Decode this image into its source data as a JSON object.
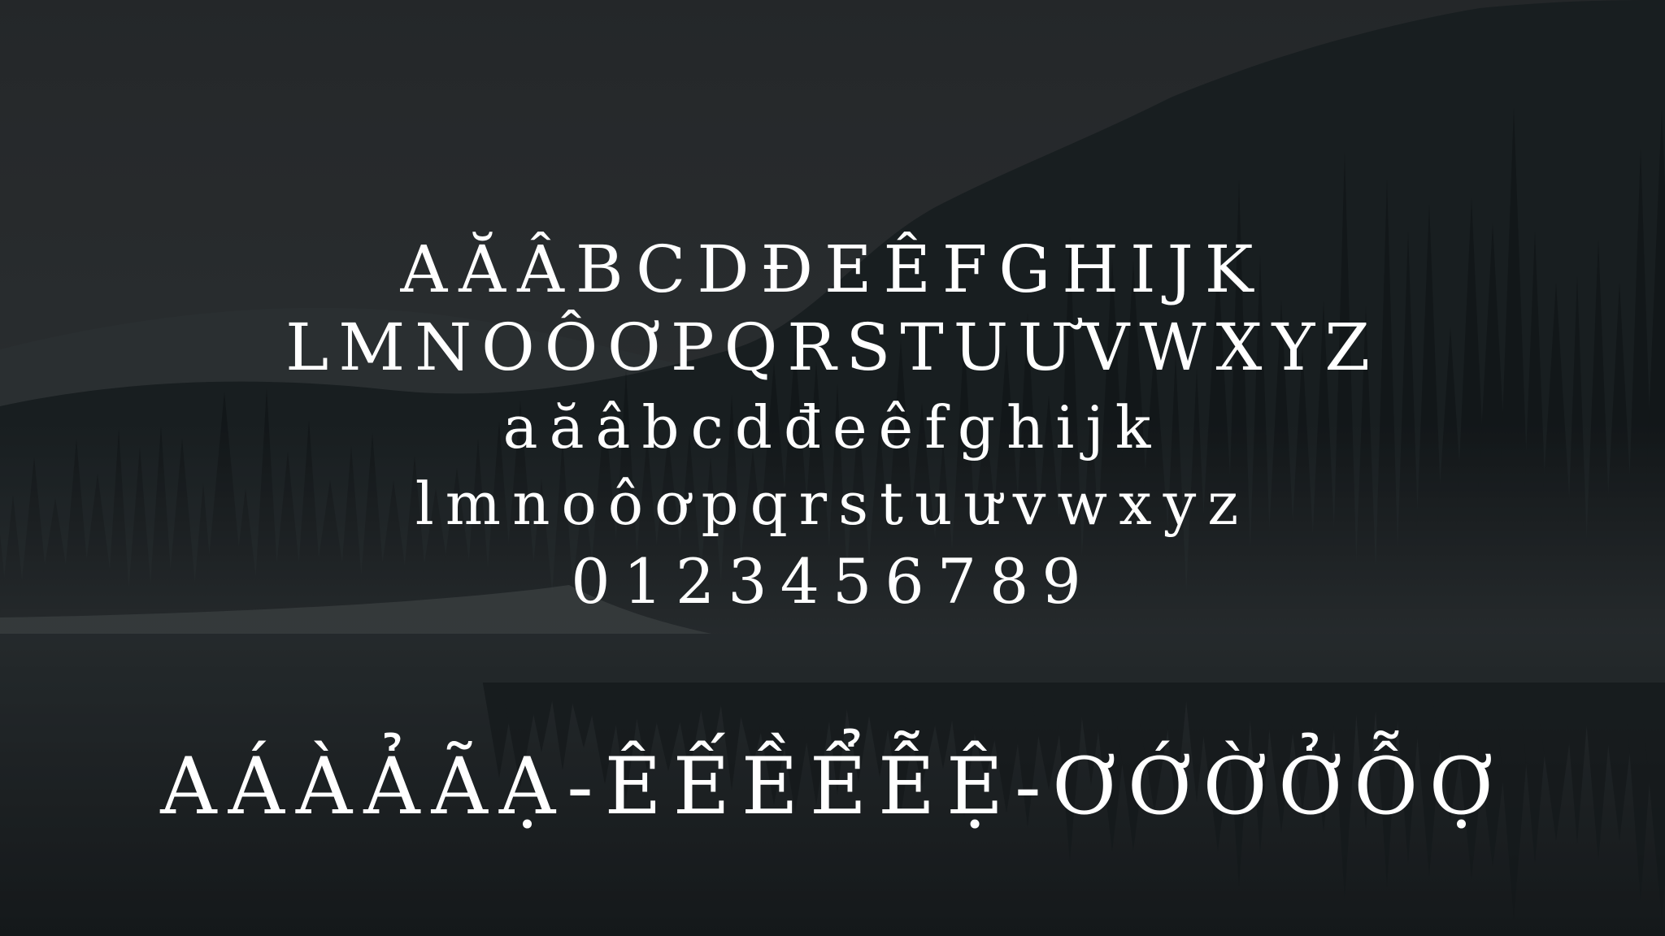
{
  "specimen": {
    "uppercase_line_1": "AĂÂBCDĐEÊFGHIJK",
    "uppercase_line_2": "LMNOÔƠPQRSTUƯVWXYZ",
    "lowercase_line_1": "aăâbcdđeêfghijk",
    "lowercase_line_2": "lmnoôơpqrstuưvwxyz",
    "digits": "0123456789",
    "diacritics": "AÁÀẢÃẠ-ÊẾỀỂỄỆ-ƠỚỜỞỖỢ"
  },
  "colors": {
    "text": "#ffffff",
    "sky": "#3a3f42",
    "forest": "#1f2528",
    "water": "#2a3033"
  }
}
